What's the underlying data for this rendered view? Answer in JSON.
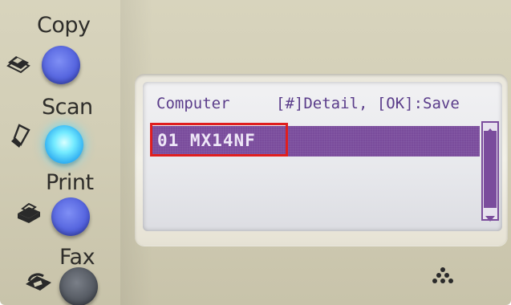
{
  "mode_buttons": [
    {
      "label": "Copy",
      "icon": "copy-icon"
    },
    {
      "label": "Scan",
      "icon": "scan-icon"
    },
    {
      "label": "Print",
      "icon": "print-icon"
    },
    {
      "label": "Fax",
      "icon": "fax-icon"
    }
  ],
  "lcd": {
    "title": "Computer",
    "hint": "[#]Detail, [OK]:Save",
    "selected_item": "01 MX14NF"
  },
  "colors": {
    "lcd_accent": "#7a4c9c",
    "highlight_box": "#e01e1e",
    "scan_light": "#4fd8ff",
    "panel": "#d2ceb6"
  },
  "logo_icon": "brand-dots-icon"
}
